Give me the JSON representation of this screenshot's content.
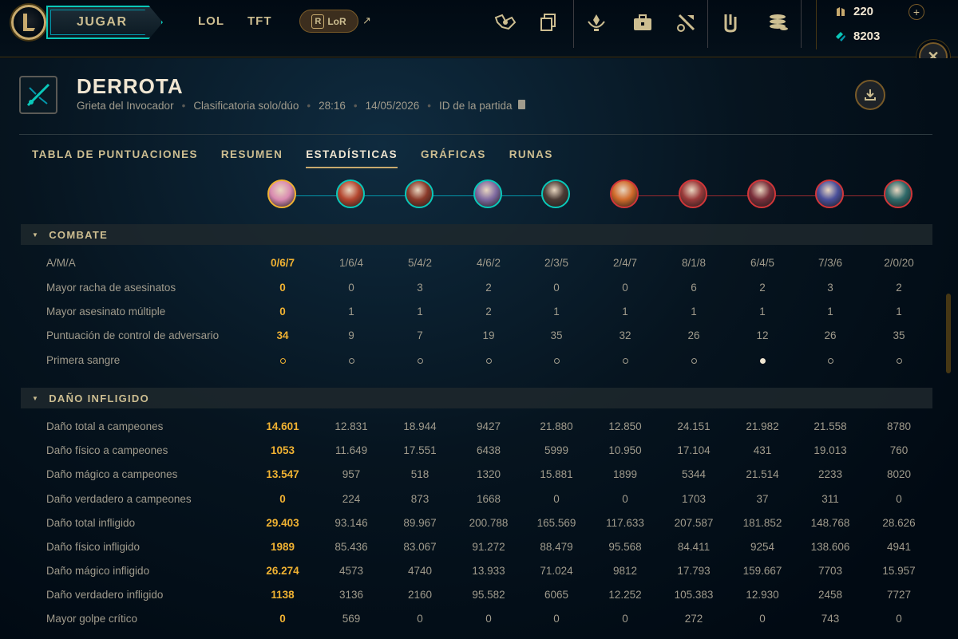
{
  "nav": {
    "play_label": "JUGAR",
    "links": [
      "LOL",
      "TFT"
    ],
    "lor_label": "LoR",
    "lor_letter": "R",
    "currency": {
      "rp": "220",
      "be": "8203"
    }
  },
  "match": {
    "result": "DERROTA",
    "map": "Grieta del Invocador",
    "queue": "Clasificatoria solo/dúo",
    "duration": "28:16",
    "date": "14/05/2026",
    "id_label": "ID de la partida"
  },
  "tabs": [
    "TABLA DE PUNTUACIONES",
    "RESUMEN",
    "ESTADÍSTICAS",
    "GRÁFICAS",
    "RUNAS"
  ],
  "active_tab": 2,
  "champions": [
    {
      "team": "blue",
      "self": true,
      "color": "#d98ab0"
    },
    {
      "team": "blue",
      "self": false,
      "color": "#b3462f"
    },
    {
      "team": "blue",
      "self": false,
      "color": "#8a3a2a"
    },
    {
      "team": "blue",
      "self": false,
      "color": "#7f6aa0"
    },
    {
      "team": "blue",
      "self": false,
      "color": "#4a3b35"
    },
    {
      "team": "red",
      "self": false,
      "color": "#d06a2a"
    },
    {
      "team": "red",
      "self": false,
      "color": "#9a3a3a"
    },
    {
      "team": "red",
      "self": false,
      "color": "#7a2f3a"
    },
    {
      "team": "red",
      "self": false,
      "color": "#4a4f9a"
    },
    {
      "team": "red",
      "self": false,
      "color": "#2f6a6a"
    }
  ],
  "sections": [
    {
      "title": "COMBATE",
      "rows": [
        {
          "label": "A/M/A",
          "values": [
            "0/6/7",
            "1/6/4",
            "5/4/2",
            "4/6/2",
            "2/3/5",
            "2/4/7",
            "8/1/8",
            "6/4/5",
            "7/3/6",
            "2/0/20"
          ]
        },
        {
          "label": "Mayor racha de asesinatos",
          "values": [
            "0",
            "0",
            "3",
            "2",
            "0",
            "0",
            "6",
            "2",
            "3",
            "2"
          ]
        },
        {
          "label": "Mayor asesinato múltiple",
          "values": [
            "0",
            "1",
            "1",
            "2",
            "1",
            "1",
            "1",
            "1",
            "1",
            "1"
          ]
        },
        {
          "label": "Puntuación de control de adversario",
          "values": [
            "34",
            "9",
            "7",
            "19",
            "35",
            "32",
            "26",
            "12",
            "26",
            "35"
          ]
        },
        {
          "label": "Primera sangre",
          "first_blood": [
            false,
            false,
            false,
            false,
            false,
            false,
            false,
            true,
            false,
            false
          ]
        }
      ]
    },
    {
      "title": "DAÑO INFLIGIDO",
      "rows": [
        {
          "label": "Daño total a campeones",
          "values": [
            "14.601",
            "12.831",
            "18.944",
            "9427",
            "21.880",
            "12.850",
            "24.151",
            "21.982",
            "21.558",
            "8780"
          ]
        },
        {
          "label": "Daño físico a campeones",
          "values": [
            "1053",
            "11.649",
            "17.551",
            "6438",
            "5999",
            "10.950",
            "17.104",
            "431",
            "19.013",
            "760"
          ]
        },
        {
          "label": "Daño mágico a campeones",
          "values": [
            "13.547",
            "957",
            "518",
            "1320",
            "15.881",
            "1899",
            "5344",
            "21.514",
            "2233",
            "8020"
          ]
        },
        {
          "label": "Daño verdadero a campeones",
          "values": [
            "0",
            "224",
            "873",
            "1668",
            "0",
            "0",
            "1703",
            "37",
            "311",
            "0"
          ]
        },
        {
          "label": "Daño total infligido",
          "values": [
            "29.403",
            "93.146",
            "89.967",
            "200.788",
            "165.569",
            "117.633",
            "207.587",
            "181.852",
            "148.768",
            "28.626"
          ]
        },
        {
          "label": "Daño físico infligido",
          "values": [
            "1989",
            "85.436",
            "83.067",
            "91.272",
            "88.479",
            "95.568",
            "84.411",
            "9254",
            "138.606",
            "4941"
          ]
        },
        {
          "label": "Daño mágico infligido",
          "values": [
            "26.274",
            "4573",
            "4740",
            "13.933",
            "71.024",
            "9812",
            "17.793",
            "159.667",
            "7703",
            "15.957"
          ]
        },
        {
          "label": "Daño verdadero infligido",
          "values": [
            "1138",
            "3136",
            "2160",
            "95.582",
            "6065",
            "12.252",
            "105.383",
            "12.930",
            "2458",
            "7727"
          ]
        },
        {
          "label": "Mayor golpe crítico",
          "values": [
            "0",
            "569",
            "0",
            "0",
            "0",
            "0",
            "272",
            "0",
            "743",
            "0"
          ]
        }
      ]
    }
  ]
}
